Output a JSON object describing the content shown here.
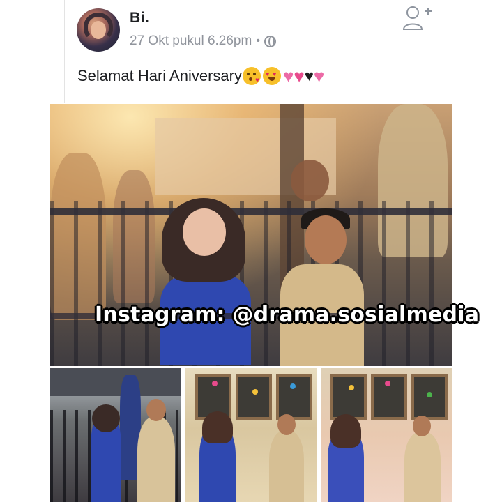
{
  "post": {
    "author": "Bi.",
    "timestamp": "27 Okt pukul 6.26pm",
    "separator": "•",
    "privacy_icon": "globe-icon",
    "text": "Selamat Hari Aniversary",
    "emojis": [
      "kissing-face-emoji",
      "heart-eyes-emoji",
      "sparkling-heart-emoji",
      "sparkling-heart-emoji",
      "black-heart-emoji",
      "sparkling-heart-emoji"
    ]
  },
  "actions": {
    "add_friend_icon": "add-friend-icon"
  },
  "photo": {
    "watermark": "Instagram: @drama.sosialmedia"
  },
  "colors": {
    "text_primary": "#1c1e21",
    "text_secondary": "#90949c",
    "watermark_text": "#ffffff",
    "watermark_outline": "#000000",
    "heart_pink": "#e84a8c",
    "black_heart": "#1c1c1c"
  }
}
